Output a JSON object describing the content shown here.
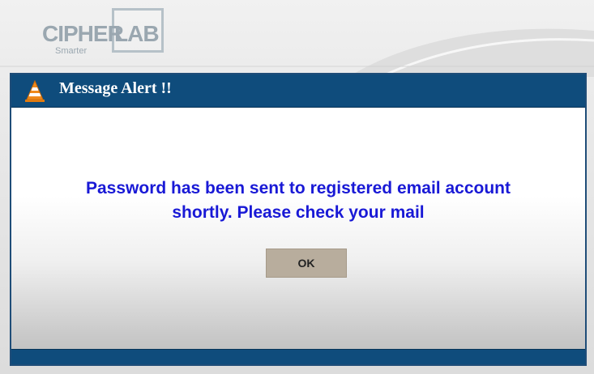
{
  "header": {
    "logo_cipher": "CIPHER",
    "logo_lab": "LAB",
    "logo_tagline": "Smarter"
  },
  "dialog": {
    "title": "Message Alert !!",
    "title_icon": "traffic-cone-icon",
    "message": "Password has been sent to registered email account shortly. Please check your mail",
    "ok_label": "OK"
  },
  "colors": {
    "titlebar": "#0f4c7c",
    "message_text": "#1919d6",
    "ok_button": "#b8ad9d",
    "logo": "#9aa7b0"
  }
}
